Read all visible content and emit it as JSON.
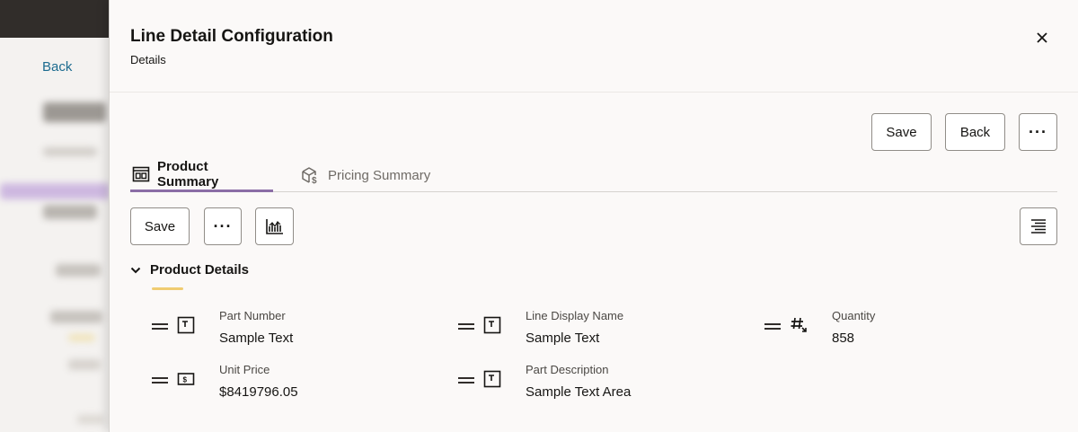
{
  "background": {
    "back_label": "Back"
  },
  "drawer": {
    "title": "Line Detail Configuration",
    "subtitle": "Details"
  },
  "toolbar": {
    "save_label": "Save",
    "back_label": "Back",
    "more_label": "···"
  },
  "tabs": [
    {
      "label": "Product Summary",
      "active": true
    },
    {
      "label": "Pricing Summary",
      "active": false
    }
  ],
  "subtoolbar": {
    "save_label": "Save",
    "more_label": "···"
  },
  "section": {
    "title": "Product Details"
  },
  "fields": [
    {
      "label": "Part Number",
      "value": "Sample Text",
      "icon": "text-field-icon"
    },
    {
      "label": "Line Display Name",
      "value": "Sample Text",
      "icon": "text-field-icon"
    },
    {
      "label": "Quantity",
      "value": "858",
      "icon": "number-field-icon"
    },
    {
      "label": "Unit Price",
      "value": "$8419796.05",
      "icon": "currency-field-icon"
    },
    {
      "label": "Part Description",
      "value": "Sample Text Area",
      "icon": "text-field-icon"
    }
  ],
  "colors": {
    "accent_tab": "#8b6ea6",
    "section_accent": "#f0cc71",
    "link": "#1c6b8f"
  }
}
